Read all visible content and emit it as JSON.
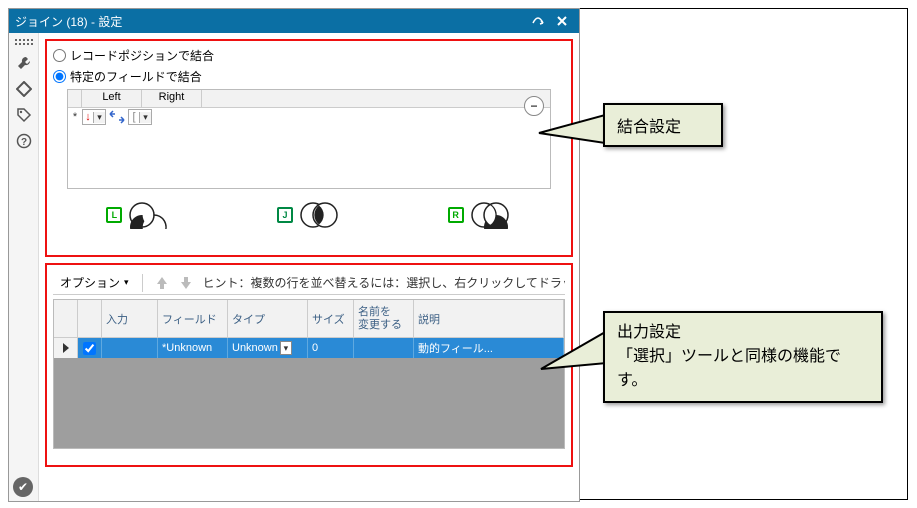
{
  "window": {
    "title": "ジョイン (18) - 設定"
  },
  "sidebar": {
    "icons": [
      "wrench-icon",
      "diamond-icon",
      "tag-icon",
      "help-icon"
    ]
  },
  "join": {
    "radio_position": "レコードポジションで結合",
    "radio_field": "特定のフィールドで結合",
    "col_left": "Left",
    "col_right": "Right",
    "row_star": "*",
    "venn_L": "L",
    "venn_J": "J",
    "venn_R": "R"
  },
  "output": {
    "options_label": "オプション",
    "hint": "ヒント：複数の行を並べ替えるには：選択し、右クリックしてドラッグし",
    "columns": {
      "input": "入力",
      "field": "フィールド",
      "type": "タイプ",
      "size": "サイズ",
      "rename": "名前を\n変更する",
      "desc": "説明"
    },
    "row": {
      "input": "",
      "field": "*Unknown",
      "type": "Unknown",
      "size": "0",
      "rename": "",
      "desc": "動的フィール..."
    }
  },
  "callout1": "結合設定",
  "callout2": "出力設定\n「選択」ツールと同様の機能です。"
}
